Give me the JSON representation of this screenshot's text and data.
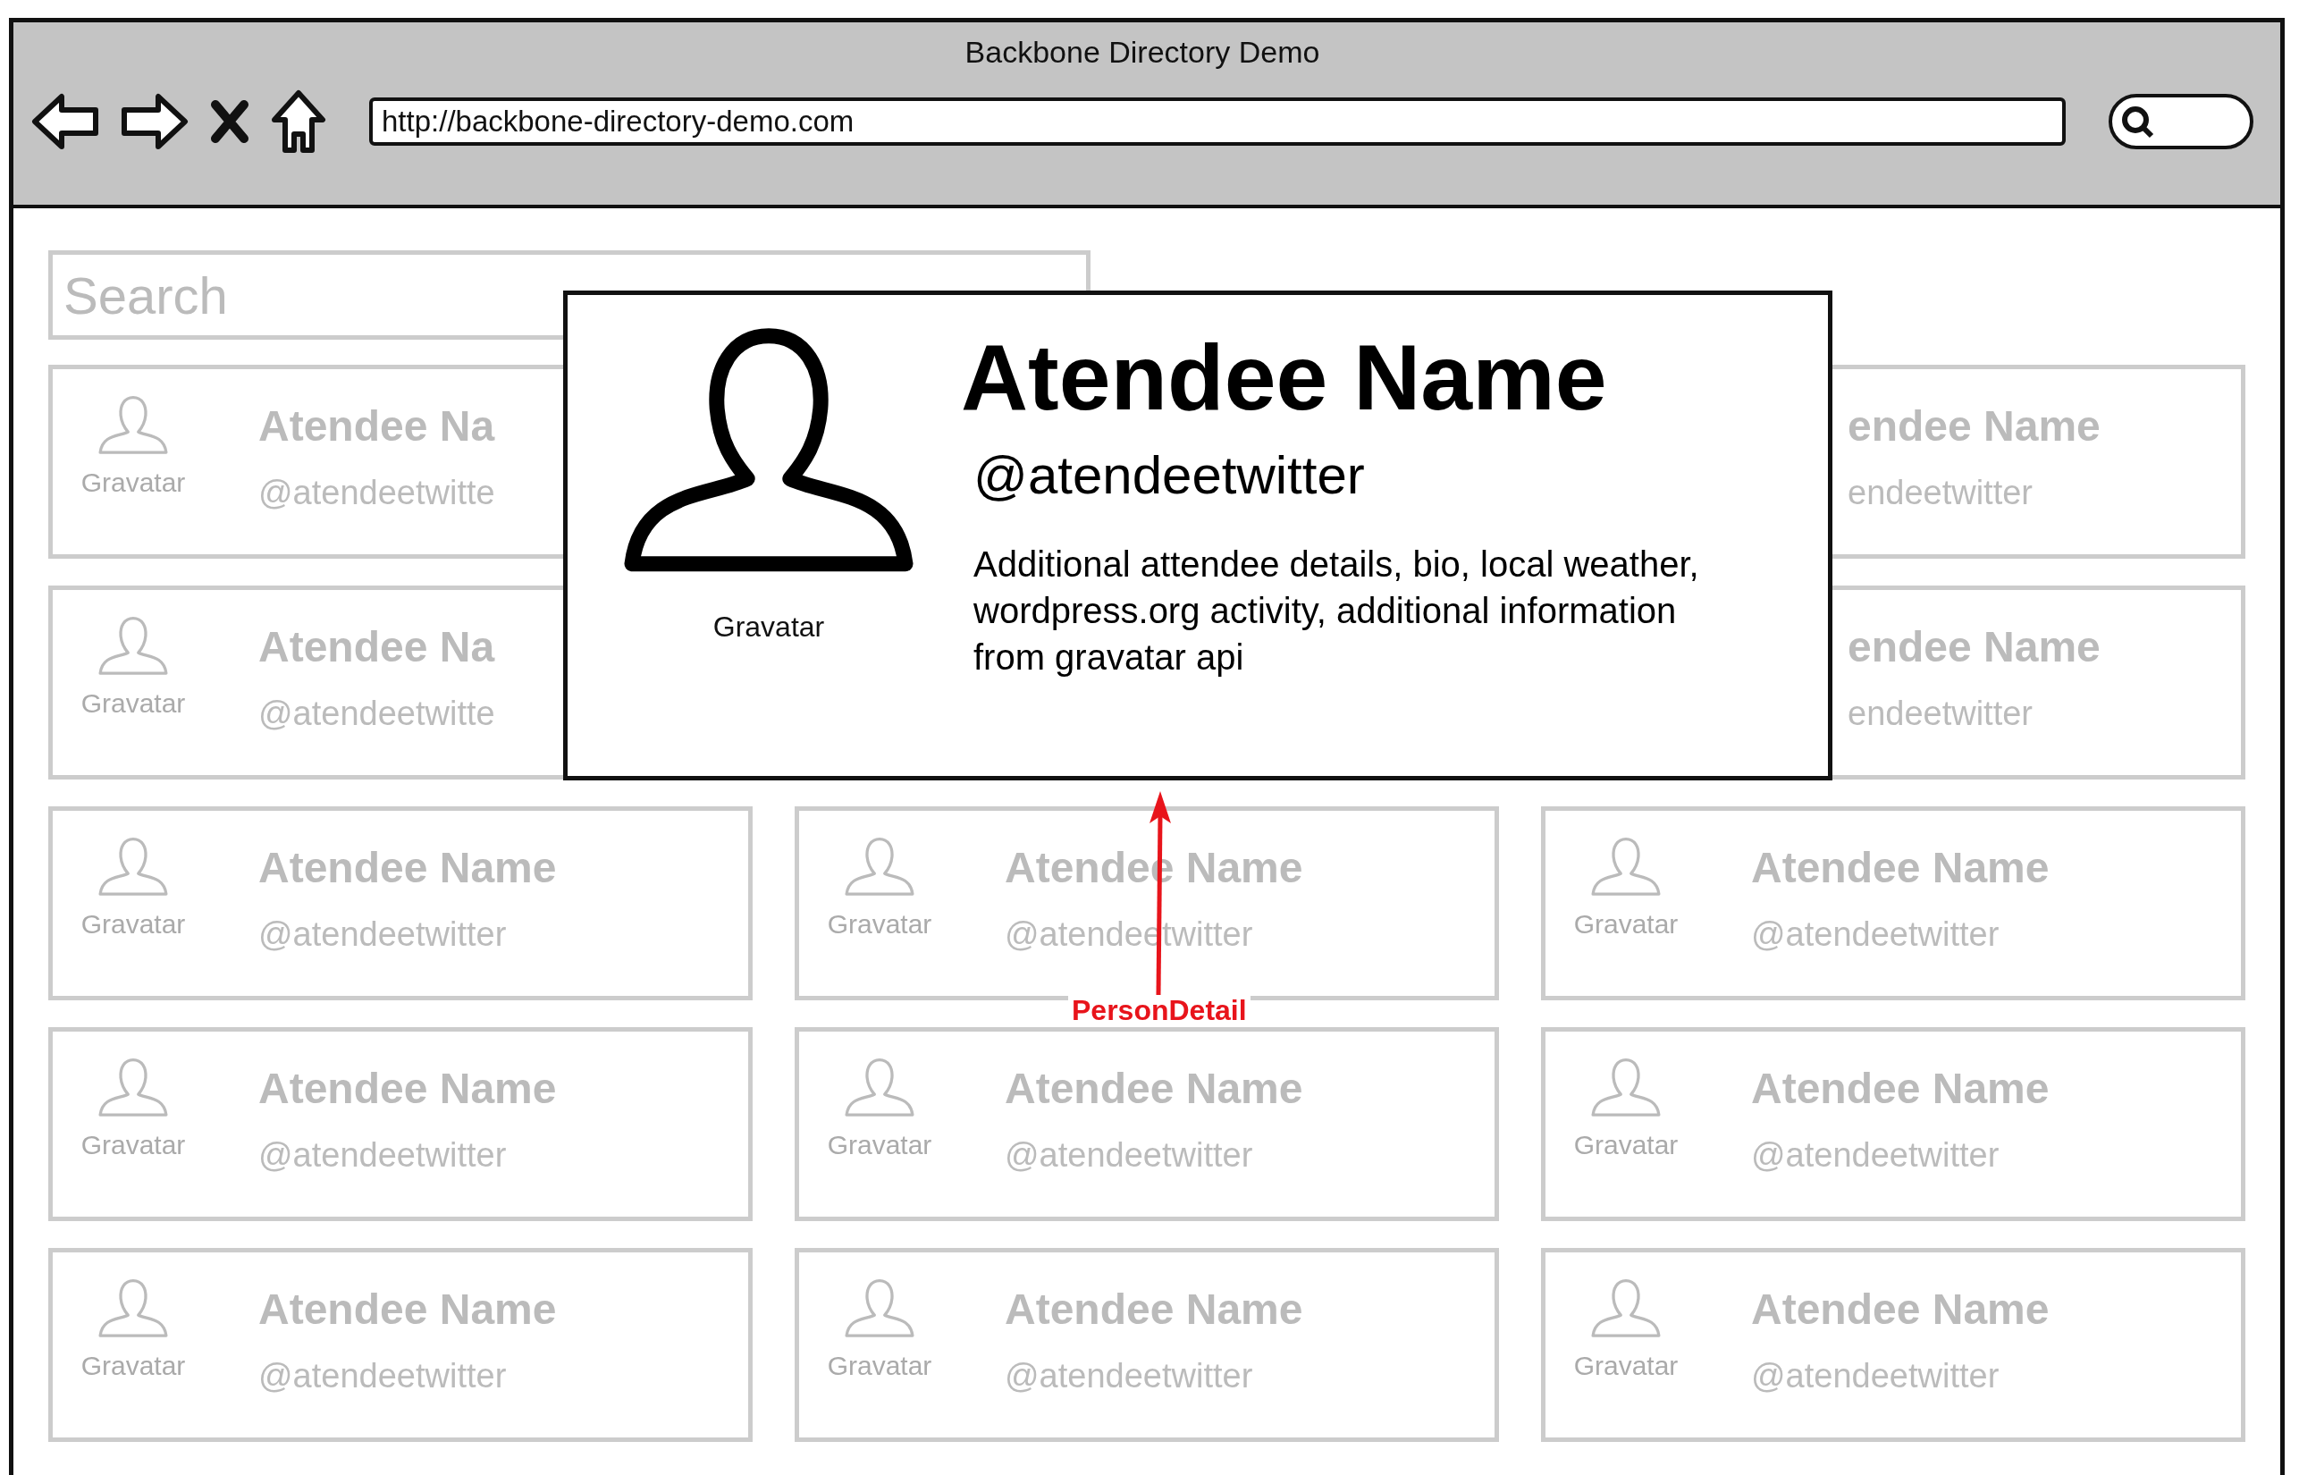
{
  "window": {
    "title": "Backbone Directory Demo"
  },
  "address_bar": {
    "url": "http://backbone-directory-demo.com"
  },
  "search": {
    "placeholder": "Search"
  },
  "rows": [
    {
      "cards": [
        {
          "avatar_label": "Gravatar",
          "name": "Atendee Na",
          "twitter": "@atendeetwitte"
        },
        {
          "name": "endee Name",
          "twitter": "endeetwitter"
        }
      ]
    },
    {
      "cards": [
        {
          "avatar_label": "Gravatar",
          "name": "Atendee Na",
          "twitter": "@atendeetwitte"
        },
        {
          "name": "endee Name",
          "twitter": "endeetwitter"
        }
      ]
    },
    {
      "cards": [
        {
          "avatar_label": "Gravatar",
          "name": "Atendee Name",
          "twitter": "@atendeetwitter"
        },
        {
          "avatar_label": "Gravatar",
          "name": "Atendee Name",
          "twitter": "@atendeetwitter"
        },
        {
          "avatar_label": "Gravatar",
          "name": "Atendee Name",
          "twitter": "@atendeetwitter"
        }
      ]
    },
    {
      "cards": [
        {
          "avatar_label": "Gravatar",
          "name": "Atendee Name",
          "twitter": "@atendeetwitter"
        },
        {
          "avatar_label": "Gravatar",
          "name": "Atendee Name",
          "twitter": "@atendeetwitter"
        },
        {
          "avatar_label": "Gravatar",
          "name": "Atendee Name",
          "twitter": "@atendeetwitter"
        }
      ]
    },
    {
      "cards": [
        {
          "avatar_label": "Gravatar",
          "name": "Atendee Name",
          "twitter": "@atendeetwitter"
        },
        {
          "avatar_label": "Gravatar",
          "name": "Atendee Name",
          "twitter": "@atendeetwitter"
        },
        {
          "avatar_label": "Gravatar",
          "name": "Atendee Name",
          "twitter": "@atendeetwitter"
        }
      ]
    }
  ],
  "detail_popup": {
    "avatar_label": "Gravatar",
    "name": "Atendee Name",
    "twitter": "@atendeetwitter",
    "details": "Additional attendee details, bio, local weather, wordpress.org activity, additional information from gravatar api"
  },
  "annotation": {
    "label": "PersonDetail"
  }
}
